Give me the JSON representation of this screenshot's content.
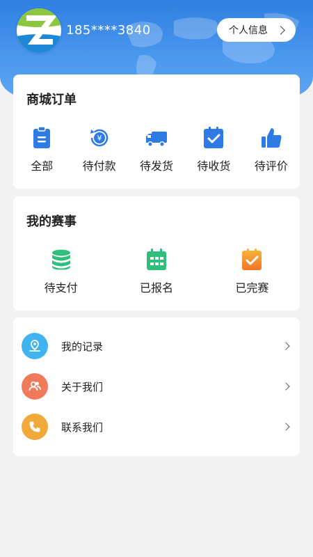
{
  "header": {
    "phone": "185****3840",
    "profile_button": "个人信息",
    "logo_icon": "z-logo-icon"
  },
  "mall_orders": {
    "title": "商城订单",
    "items": [
      {
        "label": "全部",
        "icon": "clipboard-list-icon"
      },
      {
        "label": "待付款",
        "icon": "yen-coin-icon"
      },
      {
        "label": "待发货",
        "icon": "truck-icon"
      },
      {
        "label": "待收货",
        "icon": "clipboard-check-icon"
      },
      {
        "label": "待评价",
        "icon": "thumbs-up-icon"
      }
    ]
  },
  "my_events": {
    "title": "我的赛事",
    "items": [
      {
        "label": "待支付",
        "icon": "coin-stack-icon"
      },
      {
        "label": "已报名",
        "icon": "calendar-icon"
      },
      {
        "label": "已完赛",
        "icon": "clipboard-check-orange-icon"
      }
    ]
  },
  "menu": {
    "items": [
      {
        "label": "我的记录",
        "icon": "location-pin-icon",
        "color": "#3fb4f0"
      },
      {
        "label": "关于我们",
        "icon": "users-icon",
        "color": "#f07a5a"
      },
      {
        "label": "联系我们",
        "icon": "phone-icon",
        "color": "#f0a93a"
      }
    ]
  },
  "colors": {
    "header_blue": "#2f7fe0",
    "icon_blue": "#2e7be6",
    "icon_green": "#2fbf7a",
    "icon_orange": "#f08a2a"
  }
}
